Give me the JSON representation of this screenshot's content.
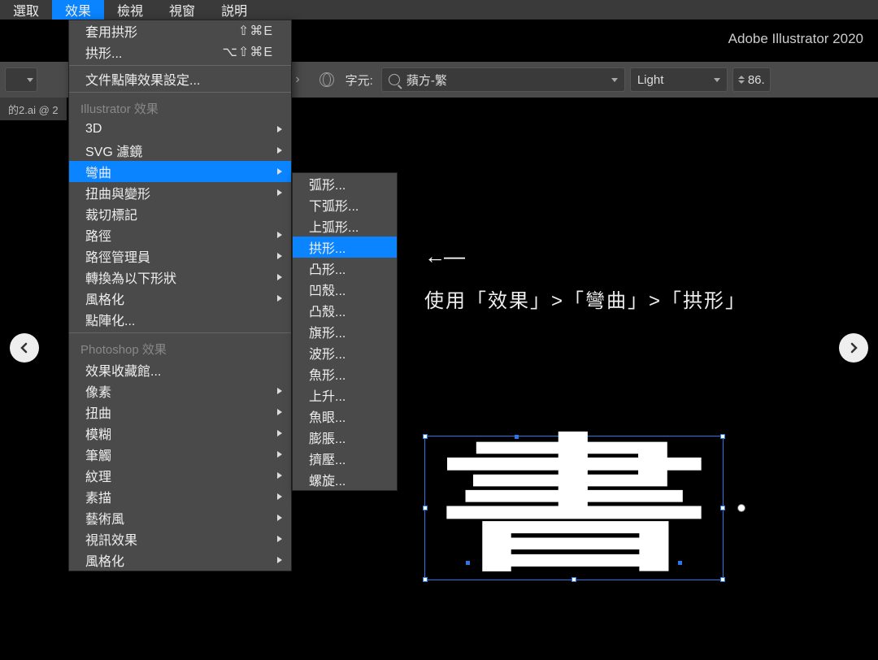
{
  "menubar": {
    "items": [
      "選取",
      "效果",
      "檢視",
      "視窗",
      "説明"
    ],
    "active_index": 1
  },
  "app_title": "Adobe Illustrator 2020",
  "control": {
    "pct_suffix": "%",
    "char_label": "字元:",
    "font_value": "蘋方-繁",
    "weight": "Light",
    "size": "86."
  },
  "tab": "的2.ai @ 2",
  "menu1": {
    "top": [
      {
        "label": "套用拱形",
        "shortcut": "⇧⌘E"
      },
      {
        "label": "拱形...",
        "shortcut": "⌥⇧⌘E"
      }
    ],
    "doc_raster": "文件點陣效果設定...",
    "ai_header": "Illustrator 效果",
    "ai_items": [
      {
        "label": "3D",
        "arrow": true
      },
      {
        "label": "SVG 濾鏡",
        "arrow": true
      },
      {
        "label": "彎曲",
        "arrow": true,
        "hl": true
      },
      {
        "label": "扭曲與變形",
        "arrow": true
      },
      {
        "label": "裁切標記"
      },
      {
        "label": "路徑",
        "arrow": true
      },
      {
        "label": "路徑管理員",
        "arrow": true
      },
      {
        "label": "轉換為以下形狀",
        "arrow": true
      },
      {
        "label": "風格化",
        "arrow": true
      },
      {
        "label": "點陣化..."
      }
    ],
    "ps_header": "Photoshop 效果",
    "ps_items": [
      {
        "label": "效果收藏館..."
      },
      {
        "label": "像素",
        "arrow": true
      },
      {
        "label": "扭曲",
        "arrow": true
      },
      {
        "label": "模糊",
        "arrow": true
      },
      {
        "label": "筆觸",
        "arrow": true
      },
      {
        "label": "紋理",
        "arrow": true
      },
      {
        "label": "素描",
        "arrow": true
      },
      {
        "label": "藝術風",
        "arrow": true
      },
      {
        "label": "視訊效果",
        "arrow": true
      },
      {
        "label": "風格化",
        "arrow": true
      }
    ]
  },
  "menu2": {
    "items": [
      {
        "label": "弧形..."
      },
      {
        "label": "下弧形..."
      },
      {
        "label": "上弧形..."
      },
      {
        "label": "拱形...",
        "hl": true
      },
      {
        "label": "凸形..."
      },
      {
        "label": "凹殼..."
      },
      {
        "label": "凸殼..."
      },
      {
        "label": "旗形..."
      },
      {
        "label": "波形..."
      },
      {
        "label": "魚形..."
      },
      {
        "label": "上升..."
      },
      {
        "label": "魚眼..."
      },
      {
        "label": "膨脹..."
      },
      {
        "label": "擠壓..."
      },
      {
        "label": "螺旋..."
      }
    ]
  },
  "arrow_ind": "←—",
  "instruction": "使用「效果」>「彎曲」>「拱形」",
  "glyph": "書"
}
